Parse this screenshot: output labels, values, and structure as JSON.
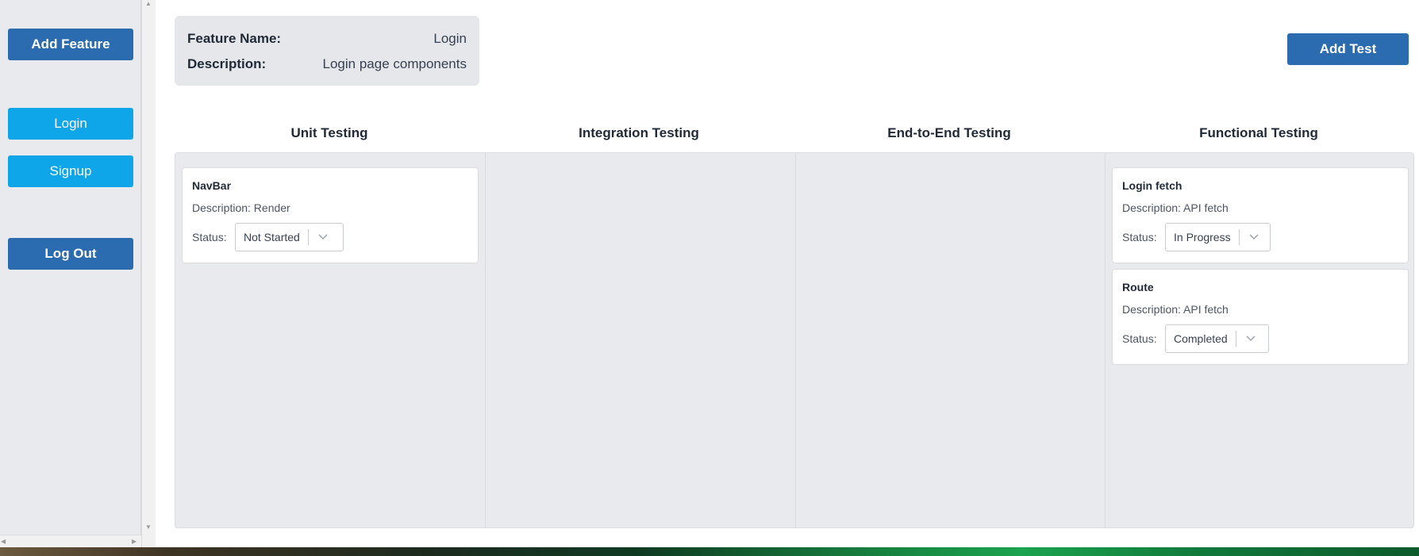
{
  "sidebar": {
    "add_feature": "Add Feature",
    "login": "Login",
    "signup": "Signup",
    "logout": "Log Out"
  },
  "feature": {
    "name_label": "Feature Name:",
    "name_value": "Login",
    "desc_label": "Description:",
    "desc_value": "Login page components"
  },
  "add_test": "Add Test",
  "columns": [
    {
      "title": "Unit Testing"
    },
    {
      "title": "Integration Testing"
    },
    {
      "title": "End-to-End Testing"
    },
    {
      "title": "Functional Testing"
    }
  ],
  "cards": {
    "unit": [
      {
        "title": "NavBar",
        "description": "Description: Render",
        "status_label": "Status:",
        "status": "Not Started"
      }
    ],
    "functional": [
      {
        "title": "Login fetch",
        "description": "Description: API fetch",
        "status_label": "Status:",
        "status": "In Progress"
      },
      {
        "title": "Route",
        "description": "Description: API fetch",
        "status_label": "Status:",
        "status": "Completed"
      }
    ]
  },
  "icons": {
    "chevron": "chevron-down-icon",
    "scroll_up": "arrow-up-icon",
    "scroll_down": "arrow-down-icon",
    "scroll_left": "arrow-left-icon",
    "scroll_right": "arrow-right-icon"
  },
  "colors": {
    "primary_button": "#2b6cb0",
    "secondary_button": "#0ea5e9",
    "board_bg": "#e9eaee"
  }
}
